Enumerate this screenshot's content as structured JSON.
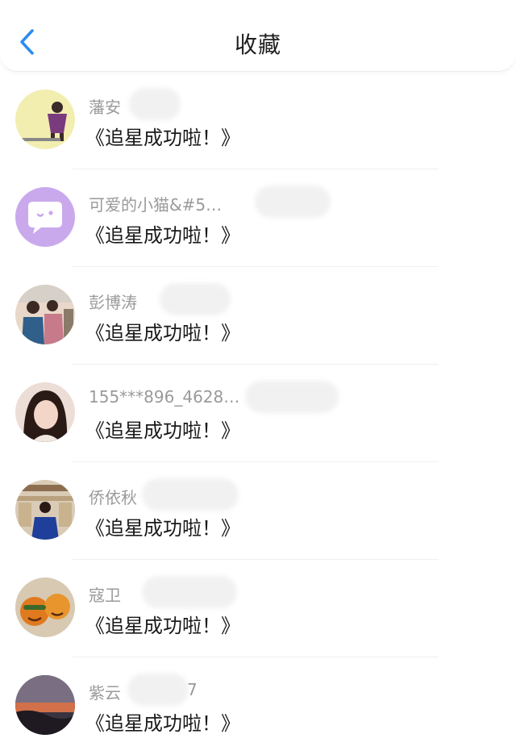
{
  "header": {
    "title": "收藏",
    "back_icon": "chevron-left-icon",
    "accent": "#2b8cf0"
  },
  "items": [
    {
      "name": "藩安",
      "message": "《追星成功啦！》",
      "suffix": ""
    },
    {
      "name": "可爱的小猫&#5…",
      "message": "《追星成功啦！》",
      "suffix": ""
    },
    {
      "name": "彭博涛",
      "message": "《追星成功啦！》",
      "suffix": ""
    },
    {
      "name": "155***896_4628…",
      "message": "《追星成功啦！》",
      "suffix": ""
    },
    {
      "name": "侨依秋",
      "message": "《追星成功啦！》",
      "suffix": ""
    },
    {
      "name": "寇卫",
      "message": "《追星成功啦！》",
      "suffix": ""
    },
    {
      "name": "紫云",
      "message": "《追星成功啦！》",
      "suffix": "7"
    }
  ]
}
